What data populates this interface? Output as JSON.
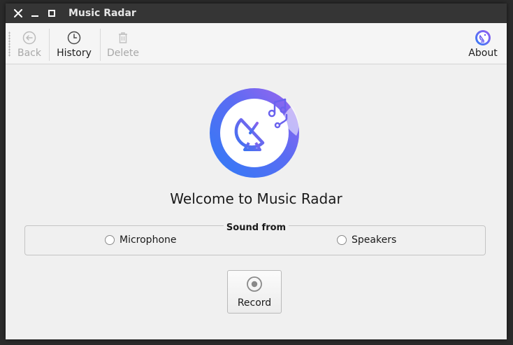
{
  "window": {
    "title": "Music Radar",
    "controls": {
      "close": "close-icon",
      "minimize": "minimize-icon",
      "maximize": "maximize-icon"
    }
  },
  "toolbar": {
    "back_label": "Back",
    "history_label": "History",
    "delete_label": "Delete",
    "about_label": "About",
    "back_enabled": false,
    "history_enabled": true,
    "delete_enabled": false,
    "about_enabled": true
  },
  "main": {
    "welcome_text": "Welcome to Music Radar",
    "sound_from": {
      "title": "Sound from",
      "options": [
        "Microphone",
        "Speakers"
      ],
      "selected": null
    },
    "record_label": "Record"
  },
  "colors": {
    "titlebar": "#353535",
    "accent_blue": "#2f7cf6",
    "accent_purple": "#8b5cf6"
  }
}
